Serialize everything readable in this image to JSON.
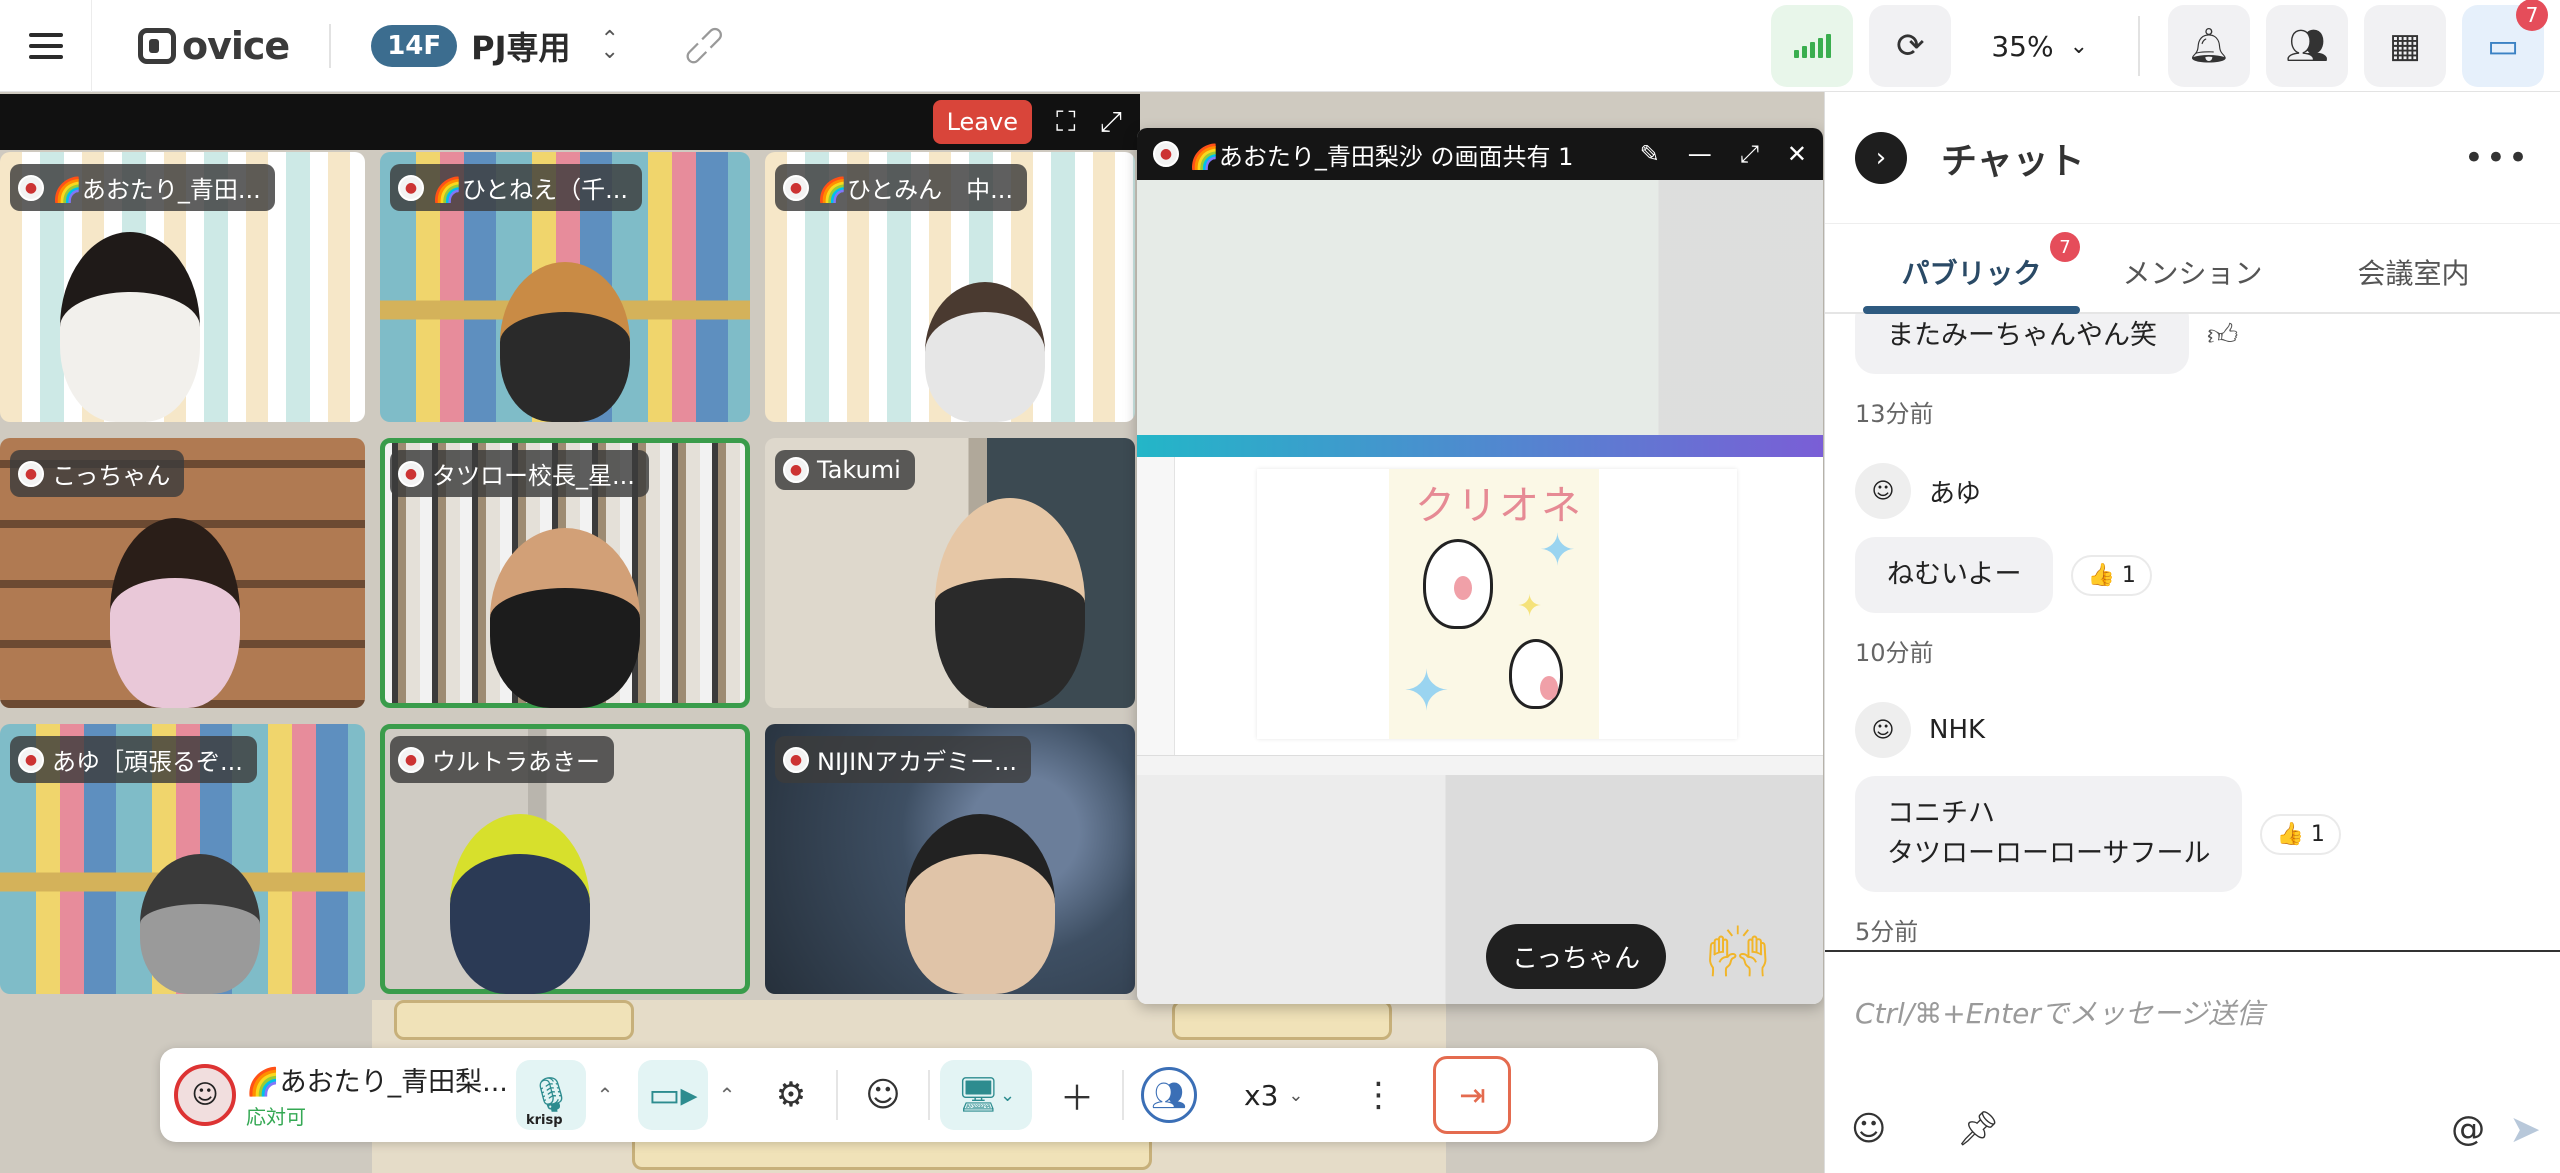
{
  "topbar": {
    "logo": "ovice",
    "floor": "14F",
    "space_name": "PJ専用",
    "zoom": "35%",
    "chat_badge": "7"
  },
  "video": {
    "leave_label": "Leave",
    "participants": [
      {
        "name": "🌈あおたり_青田..."
      },
      {
        "name": "🌈ひとねえ（千..."
      },
      {
        "name": "🌈ひとみん　中..."
      },
      {
        "name": "こっちゃん"
      },
      {
        "name": "タツロー校長_星..."
      },
      {
        "name": "Takumi"
      },
      {
        "name": "あゆ［頑張るぞ..."
      },
      {
        "name": "ウルトラあきー"
      },
      {
        "name": "NIJINアカデミー..."
      }
    ]
  },
  "screen_share": {
    "title": "🌈あおたり_青田梨沙 の画面共有 1",
    "art_title": "クリオネ"
  },
  "overlay": {
    "name_bubble": "こっちゃん"
  },
  "toolbar": {
    "my_name": "🌈あおたり_青田梨...",
    "my_status": "応対可",
    "krisp": "krisp",
    "speed": "x3"
  },
  "chat": {
    "title": "チャット",
    "tabs": [
      {
        "label": "パブリック",
        "badge": "7"
      },
      {
        "label": "メンション"
      },
      {
        "label": "会議室内"
      }
    ],
    "messages": [
      {
        "text": "またみーちゃんやん笑",
        "time": "13分前"
      },
      {
        "sender": "あゆ",
        "text": "ねむいよー",
        "reaction": "👍 1",
        "time": "10分前"
      },
      {
        "sender": "NHK",
        "text_line1": "コニチハ",
        "text_line2": "タツローローローサフール",
        "reaction": "👍 1",
        "time": "5分前"
      }
    ],
    "input_placeholder": "Ctrl/⌘+Enterでメッセージ送信"
  }
}
